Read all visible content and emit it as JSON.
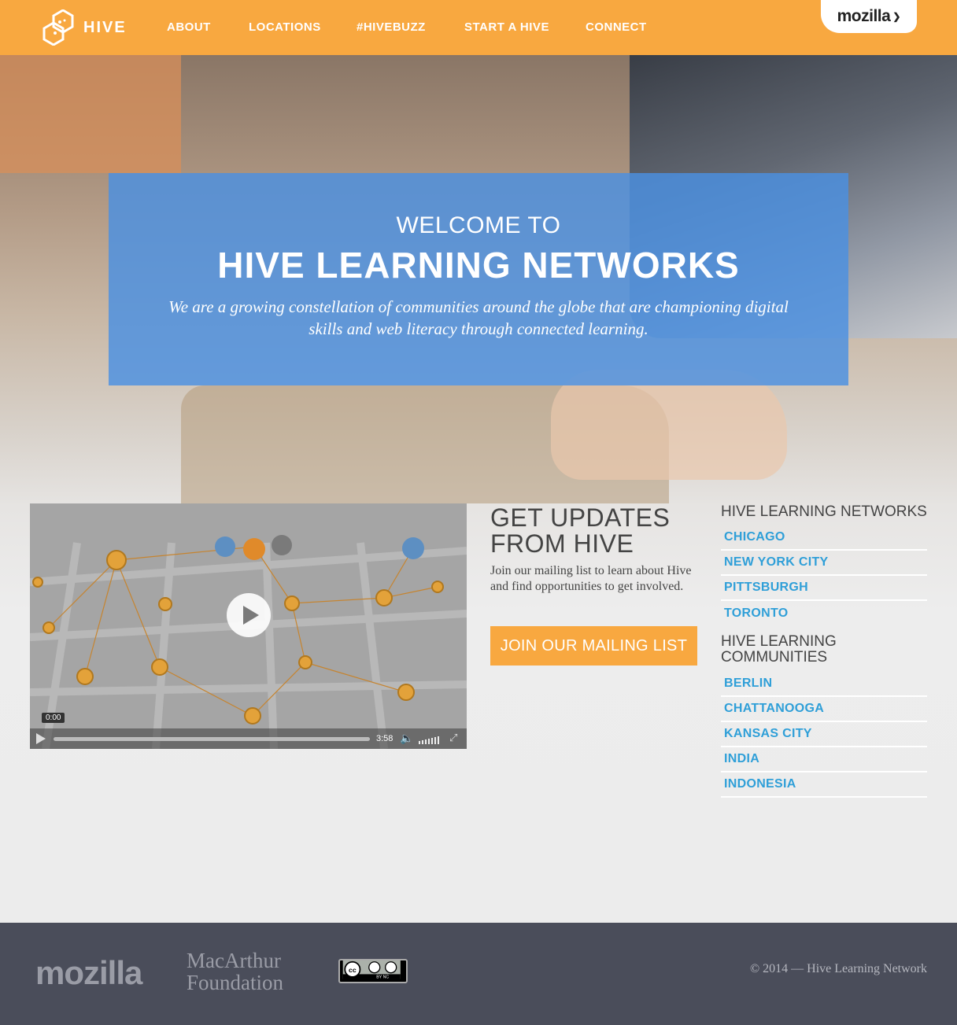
{
  "brand": {
    "logo_text": "HIVE",
    "mozilla_tab": "mozilla"
  },
  "nav": {
    "items": [
      {
        "label": "ABOUT"
      },
      {
        "label": "LOCATIONS"
      },
      {
        "label": "#HIVEBUZZ"
      },
      {
        "label": "START A HIVE"
      },
      {
        "label": "CONNECT"
      }
    ]
  },
  "hero": {
    "welcome": "WELCOME TO",
    "title": "HIVE LEARNING NETWORKS",
    "subtitle": "We are a growing constellation of communities around the globe that are championing digital skills and web literacy through connected learning."
  },
  "video": {
    "current_time": "0:00",
    "duration": "3:58"
  },
  "updates": {
    "title": "GET UPDATES FROM HIVE",
    "body": "Join our mailing list to learn about Hive and find opportunities to get involved.",
    "button": "JOIN OUR MAILING LIST"
  },
  "sidebar": {
    "networks_heading": "HIVE LEARNING NETWORKS",
    "networks": [
      {
        "label": "CHICAGO"
      },
      {
        "label": "NEW YORK CITY"
      },
      {
        "label": "PITTSBURGH"
      },
      {
        "label": "TORONTO"
      }
    ],
    "communities_heading": "HIVE LEARNING COMMUNITIES",
    "communities": [
      {
        "label": "BERLIN"
      },
      {
        "label": "CHATTANOOGA"
      },
      {
        "label": "KANSAS CITY"
      },
      {
        "label": "INDIA"
      },
      {
        "label": "INDONESIA"
      }
    ]
  },
  "footer": {
    "mozilla": "mozilla",
    "macarthur": "MacArthur Foundation",
    "cc_label": "BY NC",
    "copyright": "© 2014 — Hive Learning Network"
  },
  "colors": {
    "nav": "#f8a840",
    "hero_card": "#4a90e2",
    "link": "#2f9fd8",
    "footer": "#4a4d5a"
  }
}
